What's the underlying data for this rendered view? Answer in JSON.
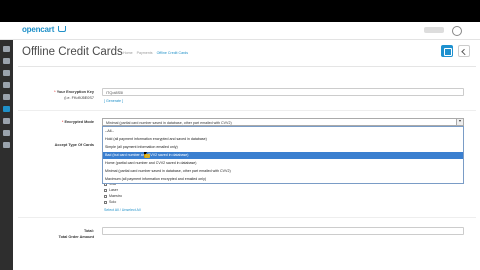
{
  "header": {
    "logo": "opencart",
    "logo_icon": "cart-icon"
  },
  "page": {
    "title": "Offline Credit Cards"
  },
  "breadcrumb": [
    "Home",
    "Payments",
    "Offline Credit Cards"
  ],
  "toolbar": {
    "save_icon": "save-icon",
    "back_icon": "back-icon"
  },
  "form": {
    "encryption_key": {
      "label_line1": "Your Encryption Key",
      "label_line2": "(i.e. FKd9J5E0S7",
      "value": "ITQot8S5l",
      "generate": "[ Generate ]"
    },
    "encrypted_mode": {
      "label": "Encrypted Mode",
      "value": "Minimal (partial card number saved in database, other part emailed with CVV2)"
    },
    "accept_cards": {
      "label": "Accept Type Of Cards",
      "cards": [
        "Visa",
        "Laser",
        "Maestro",
        "Solo"
      ],
      "select_links": "Select All / Unselect All"
    },
    "total": {
      "label_line1": "Total:",
      "label_line2": "Total Order Amount"
    }
  },
  "dropdown": {
    "options": [
      "--All--",
      "Hold (all payment information encrypted and saved in database)",
      "Simple (all payment information emailed only)",
      "Bad (but card number and CVV2 saved in database)",
      "Home (partial card number and CVV2 saved in database)",
      "Minimal (partial card number saved in database, other part emailed with CVV2)",
      "Maximum (all payment information encrypted and emailed only)"
    ],
    "selected_index": 3
  },
  "colors": {
    "accent": "#1e91cf",
    "selected_option": "#3a7fd0",
    "sidebar": "#2e2e2e"
  }
}
